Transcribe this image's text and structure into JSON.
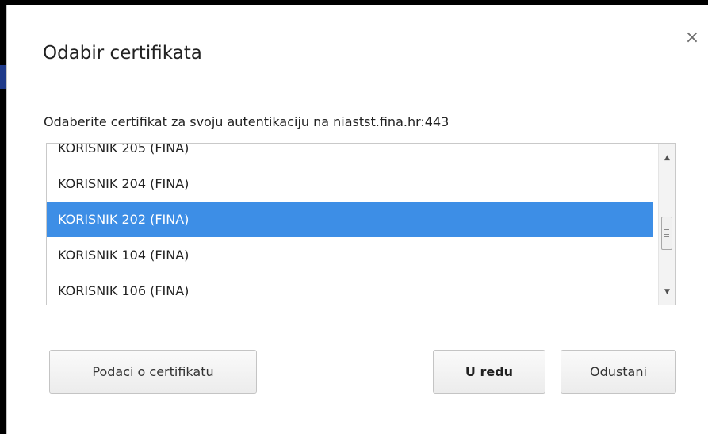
{
  "dialog": {
    "title": "Odabir certifikata",
    "subtitle": "Odaberite certifikat za svoju autentikaciju na niastst.fina.hr:443",
    "close_icon": "×"
  },
  "certificates": {
    "items": [
      "KORISNIK 205 (FINA)",
      "KORISNIK 204 (FINA)",
      "KORISNIK 202 (FINA)",
      "KORISNIK 104 (FINA)",
      "KORISNIK 106 (FINA)"
    ],
    "selected": "KORISNIK 202 (FINA)"
  },
  "scrollbar": {
    "up_arrow": "▲",
    "down_arrow": "▼"
  },
  "buttons": {
    "details_label": "Podaci o certifikatu",
    "ok_label": "U redu",
    "cancel_label": "Odustani"
  },
  "colors": {
    "selection": "#3d8ee6",
    "text": "#222222"
  }
}
